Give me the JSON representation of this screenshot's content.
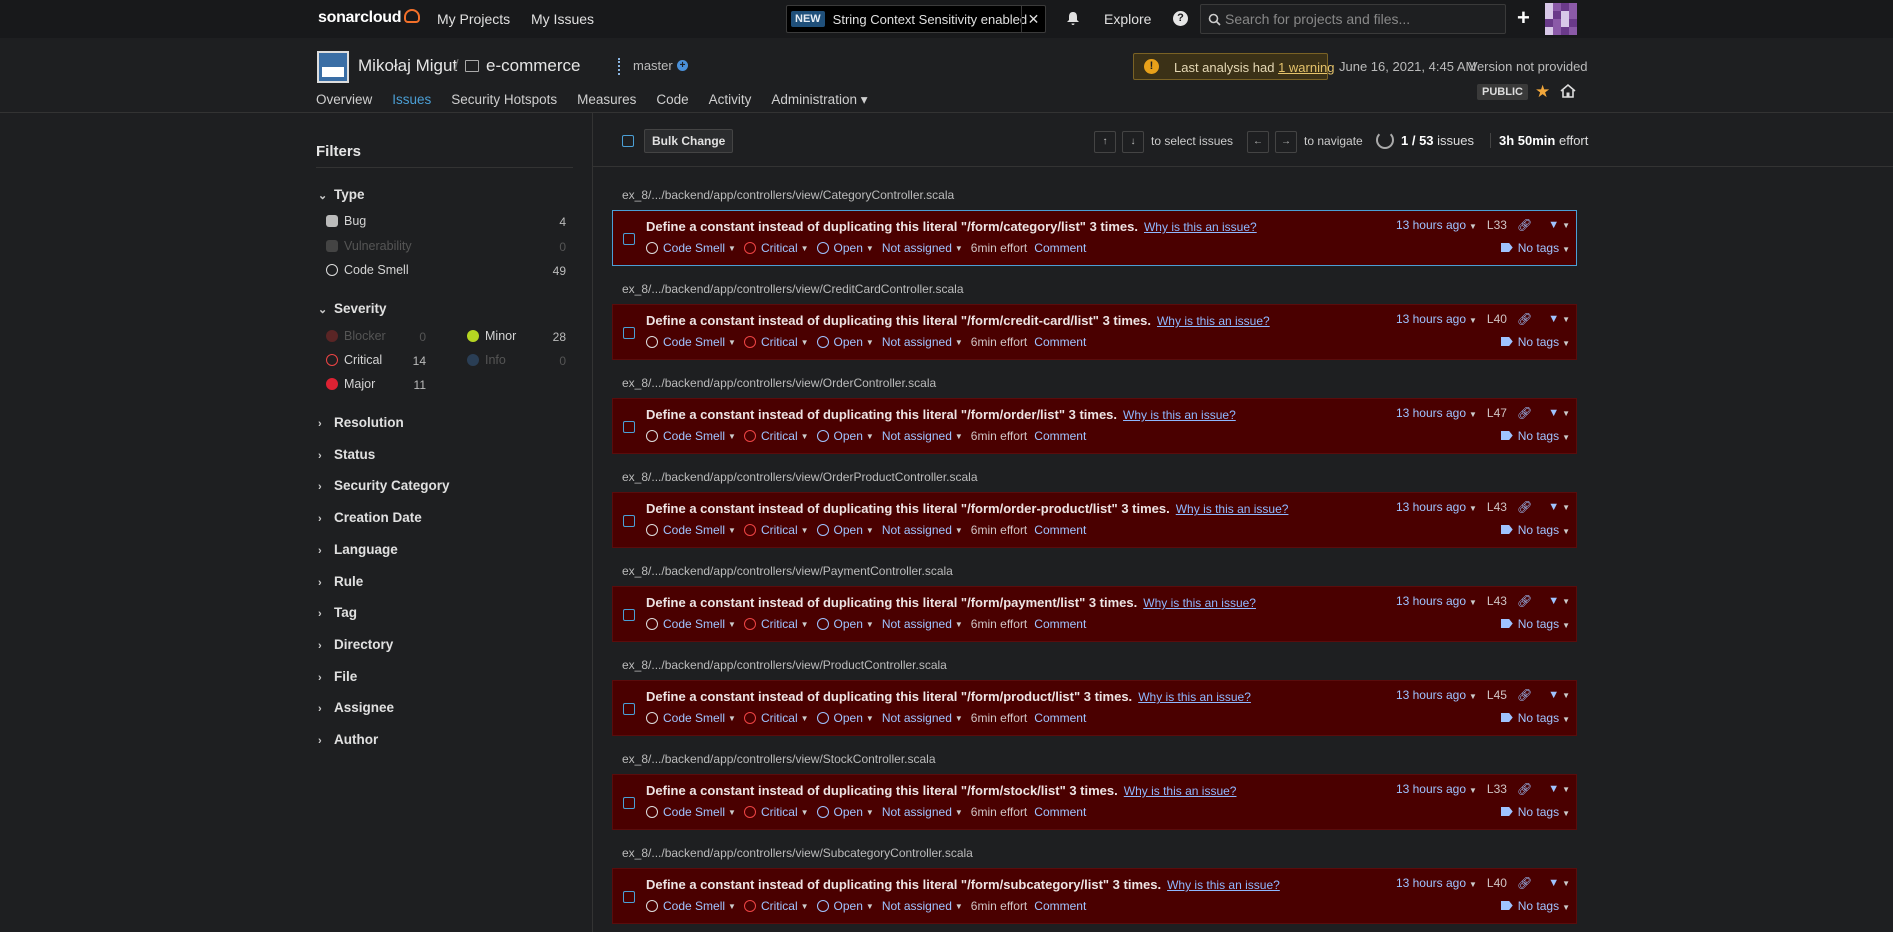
{
  "topnav": {
    "logo": "sonarcloud",
    "my_projects": "My Projects",
    "my_issues": "My Issues",
    "new_badge": "NEW",
    "new_text": "String Context Sensitivity enabled",
    "close": "✕",
    "explore": "Explore",
    "help": "?",
    "search_placeholder": "Search for projects and files..."
  },
  "project": {
    "org": "Mikołaj Migut",
    "separator": "/",
    "name": "e-commerce",
    "branch": "master",
    "warning_prefix": "Last analysis had",
    "warning_link": "1 warning",
    "analysis_date": "June 16, 2021, 4:45 AM",
    "version": "Version not provided",
    "visibility": "PUBLIC",
    "tabs": [
      "Overview",
      "Issues",
      "Security Hotspots",
      "Measures",
      "Code",
      "Activity",
      "Administration ▾"
    ]
  },
  "filters": {
    "title": "Filters",
    "type_label": "Type",
    "types": [
      {
        "label": "Bug",
        "count": "4"
      },
      {
        "label": "Vulnerability",
        "count": "0"
      },
      {
        "label": "Code Smell",
        "count": "49"
      }
    ],
    "severity_label": "Severity",
    "severities": [
      {
        "label": "Blocker",
        "count": "0"
      },
      {
        "label": "Minor",
        "count": "28"
      },
      {
        "label": "Critical",
        "count": "14"
      },
      {
        "label": "Info",
        "count": "0"
      },
      {
        "label": "Major",
        "count": "11"
      }
    ],
    "collapsed": [
      "Resolution",
      "Status",
      "Security Category",
      "Creation Date",
      "Language",
      "Rule",
      "Tag",
      "Directory",
      "File",
      "Assignee",
      "Author"
    ]
  },
  "toolbar": {
    "bulk_change": "Bulk Change",
    "up": "↑",
    "down": "↓",
    "select_text": "to select issues",
    "left": "←",
    "right": "→",
    "navigate_text": "to navigate",
    "count_current": "1 / 53",
    "count_suffix": "issues",
    "effort_value": "3h 50min",
    "effort_suffix": "effort"
  },
  "issue_common": {
    "why": "Why is this an issue?",
    "type": "Code Smell",
    "severity": "Critical",
    "status": "Open",
    "assignee": "Not assigned",
    "effort": "6min effort",
    "comment": "Comment",
    "age": "13 hours ago",
    "tags": "No tags"
  },
  "issues": [
    {
      "component": "ex_8/.../backend/app/controllers/view/CategoryController.scala",
      "message": "Define a constant instead of duplicating this literal \"/form/category/list\" 3 times.",
      "line": "L33"
    },
    {
      "component": "ex_8/.../backend/app/controllers/view/CreditCardController.scala",
      "message": "Define a constant instead of duplicating this literal \"/form/credit-card/list\" 3 times.",
      "line": "L40"
    },
    {
      "component": "ex_8/.../backend/app/controllers/view/OrderController.scala",
      "message": "Define a constant instead of duplicating this literal \"/form/order/list\" 3 times.",
      "line": "L47"
    },
    {
      "component": "ex_8/.../backend/app/controllers/view/OrderProductController.scala",
      "message": "Define a constant instead of duplicating this literal \"/form/order-product/list\" 3 times.",
      "line": "L43"
    },
    {
      "component": "ex_8/.../backend/app/controllers/view/PaymentController.scala",
      "message": "Define a constant instead of duplicating this literal \"/form/payment/list\" 3 times.",
      "line": "L43"
    },
    {
      "component": "ex_8/.../backend/app/controllers/view/ProductController.scala",
      "message": "Define a constant instead of duplicating this literal \"/form/product/list\" 3 times.",
      "line": "L45"
    },
    {
      "component": "ex_8/.../backend/app/controllers/view/StockController.scala",
      "message": "Define a constant instead of duplicating this literal \"/form/stock/list\" 3 times.",
      "line": "L33"
    },
    {
      "component": "ex_8/.../backend/app/controllers/view/SubcategoryController.scala",
      "message": "Define a constant instead of duplicating this literal \"/form/subcategory/list\" 3 times.",
      "line": "L40"
    }
  ]
}
